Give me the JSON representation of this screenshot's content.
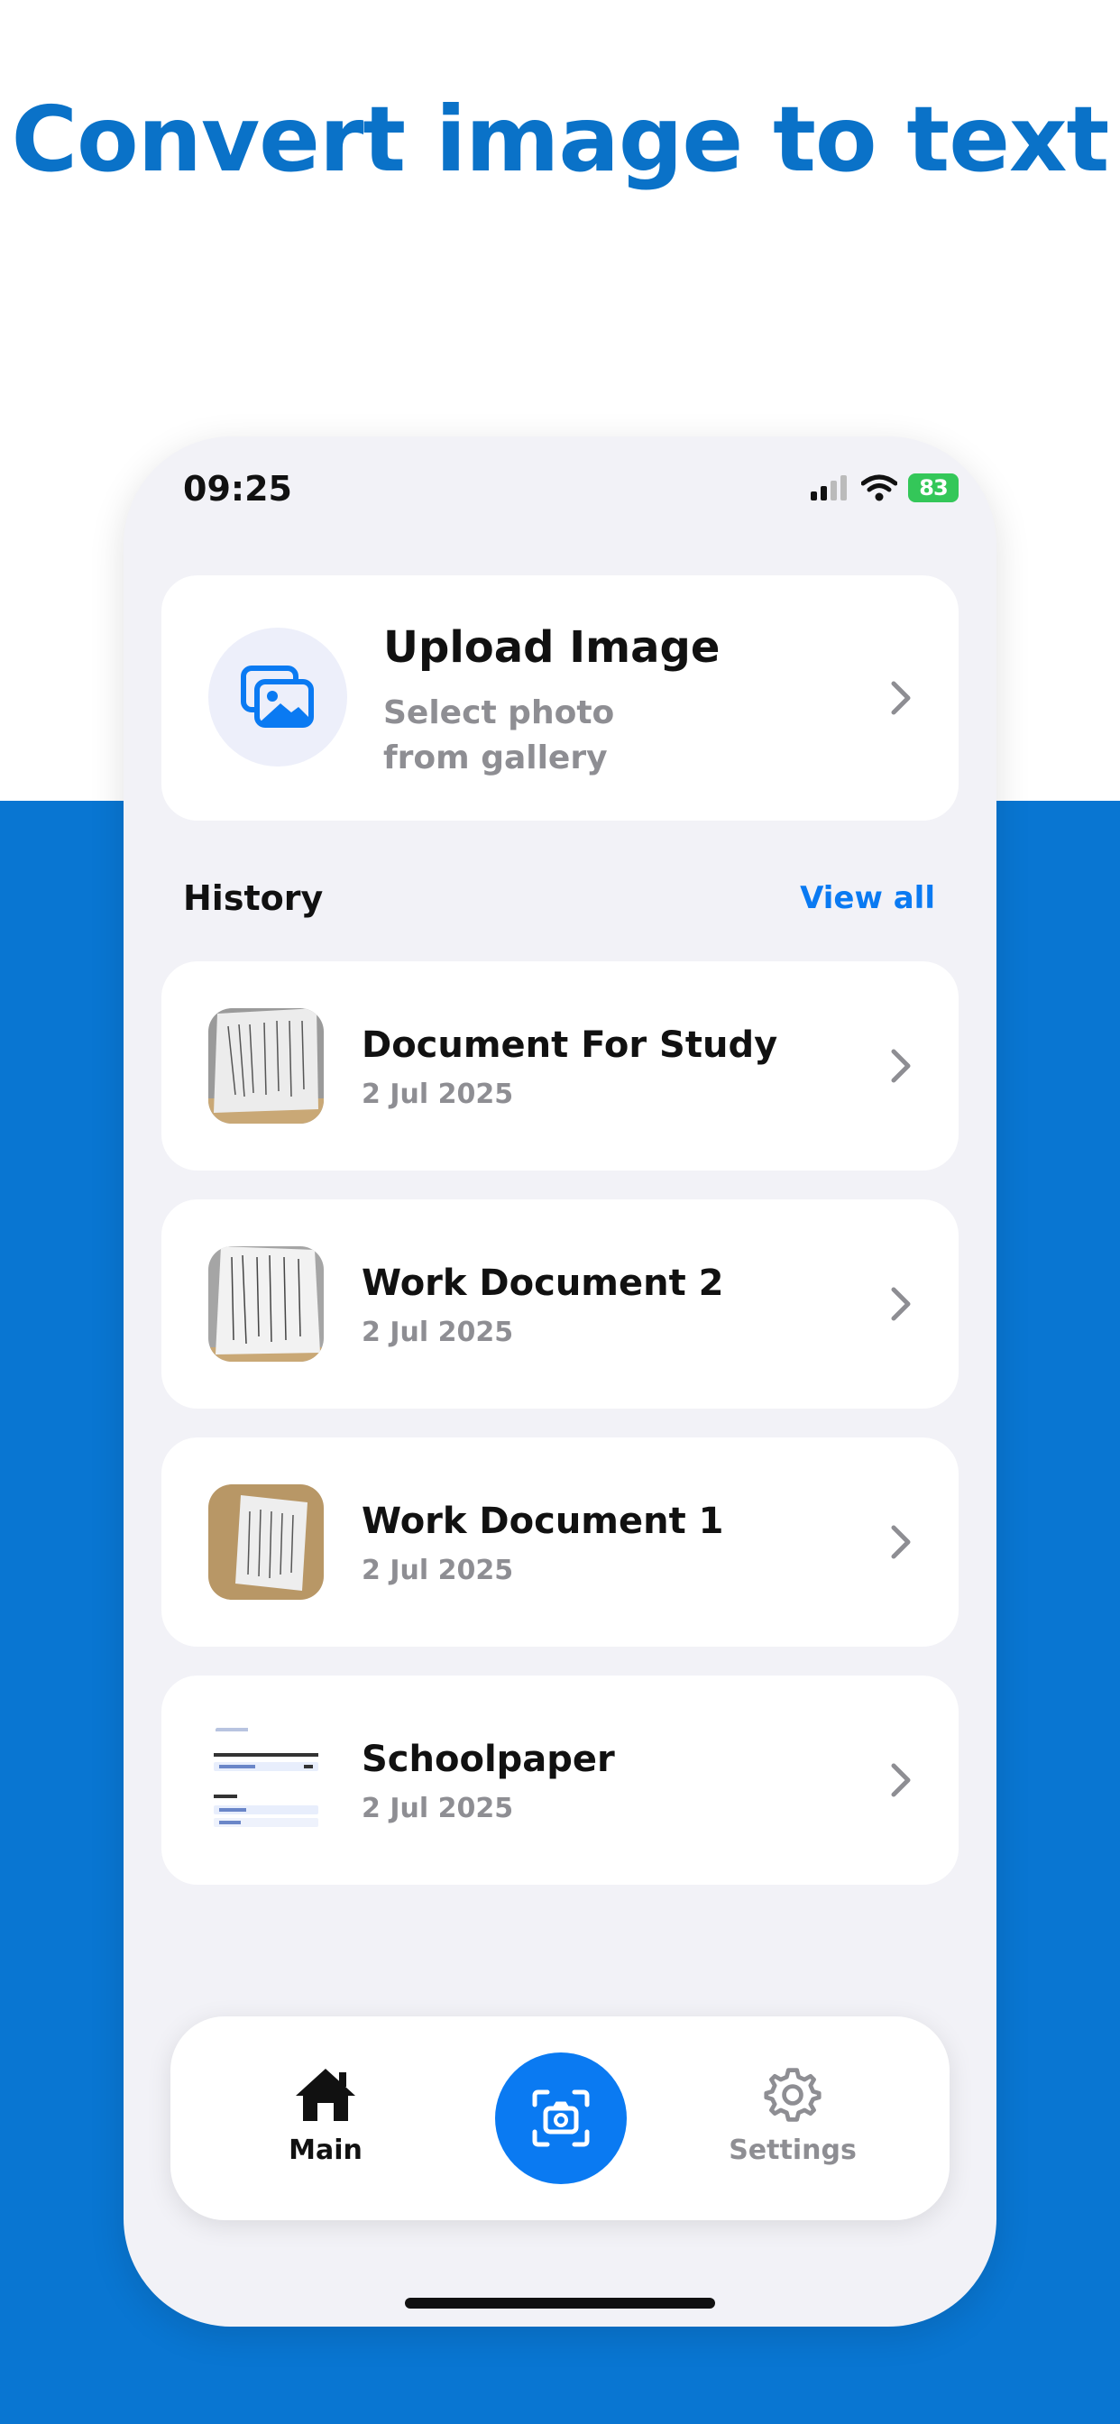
{
  "headline": "Convert image to text",
  "status_bar": {
    "time": "09:25",
    "battery": "83"
  },
  "upload": {
    "title": "Upload Image",
    "subtitle": "Select photo from gallery"
  },
  "history": {
    "title": "History",
    "view_all": "View all",
    "items": [
      {
        "name": "Document For Study",
        "date": "2 Jul 2025"
      },
      {
        "name": "Work Document 2",
        "date": "2 Jul 2025"
      },
      {
        "name": "Work Document 1",
        "date": "2 Jul 2025"
      },
      {
        "name": "Schoolpaper",
        "date": "2 Jul 2025"
      }
    ]
  },
  "tabbar": {
    "main": "Main",
    "settings": "Settings"
  },
  "colors": {
    "accent": "#0a7af2",
    "headline": "#0a72c8",
    "background_blue": "#0976d2",
    "battery": "#34c759"
  }
}
